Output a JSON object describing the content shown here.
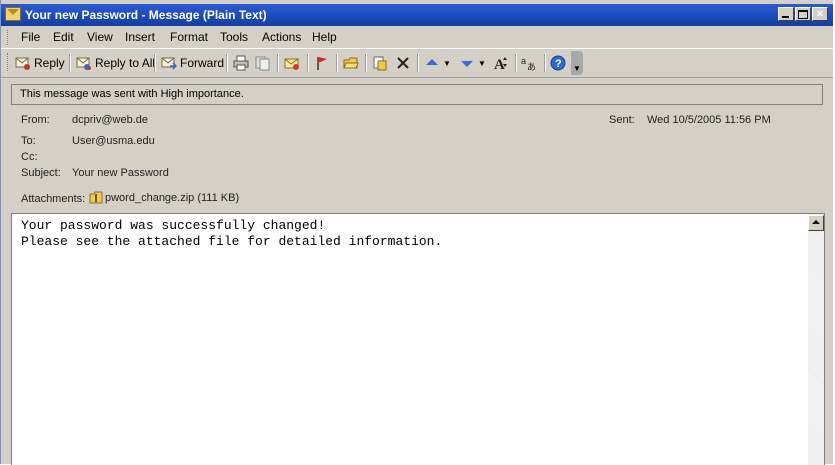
{
  "window": {
    "title": "Your new Password - Message (Plain Text)",
    "minimize_icon": "minimize-icon",
    "maximize_icon": "maximize-icon",
    "close_label": "×"
  },
  "menu": {
    "items": [
      "File",
      "Edit",
      "View",
      "Insert",
      "Format",
      "Tools",
      "Actions",
      "Help"
    ]
  },
  "toolbar": {
    "reply_label": "Reply",
    "reply_all_label": "Reply to All",
    "forward_label": "Forward",
    "icons": [
      "reply-icon",
      "reply-all-icon",
      "forward-icon",
      "print-icon",
      "copy-icon",
      "flag-envelope-icon",
      "flag-icon",
      "open-folder-icon",
      "move-icon",
      "delete-icon",
      "previous-item-icon",
      "next-item-icon",
      "font-size-icon",
      "translate-icon",
      "help-icon"
    ]
  },
  "message": {
    "importance_text": "This message was sent with High importance.",
    "from_label": "From:",
    "from_value": "dcpriv@web.de",
    "sent_label": "Sent:",
    "sent_value": "Wed 10/5/2005 11:56 PM",
    "to_label": "To:",
    "to_value": "User@usma.edu",
    "cc_label": "Cc:",
    "subject_label": "Subject:",
    "subject_value": "Your new Password",
    "attachments_label": "Attachments:",
    "attachment_name": "pword_change.zip (111 KB)",
    "body_line1": "Your password was successfully changed!",
    "body_line2": "Please see the attached file for detailed information."
  },
  "colors": {
    "titlebar": "#1c4bbd",
    "chrome": "#d4d0c8"
  }
}
